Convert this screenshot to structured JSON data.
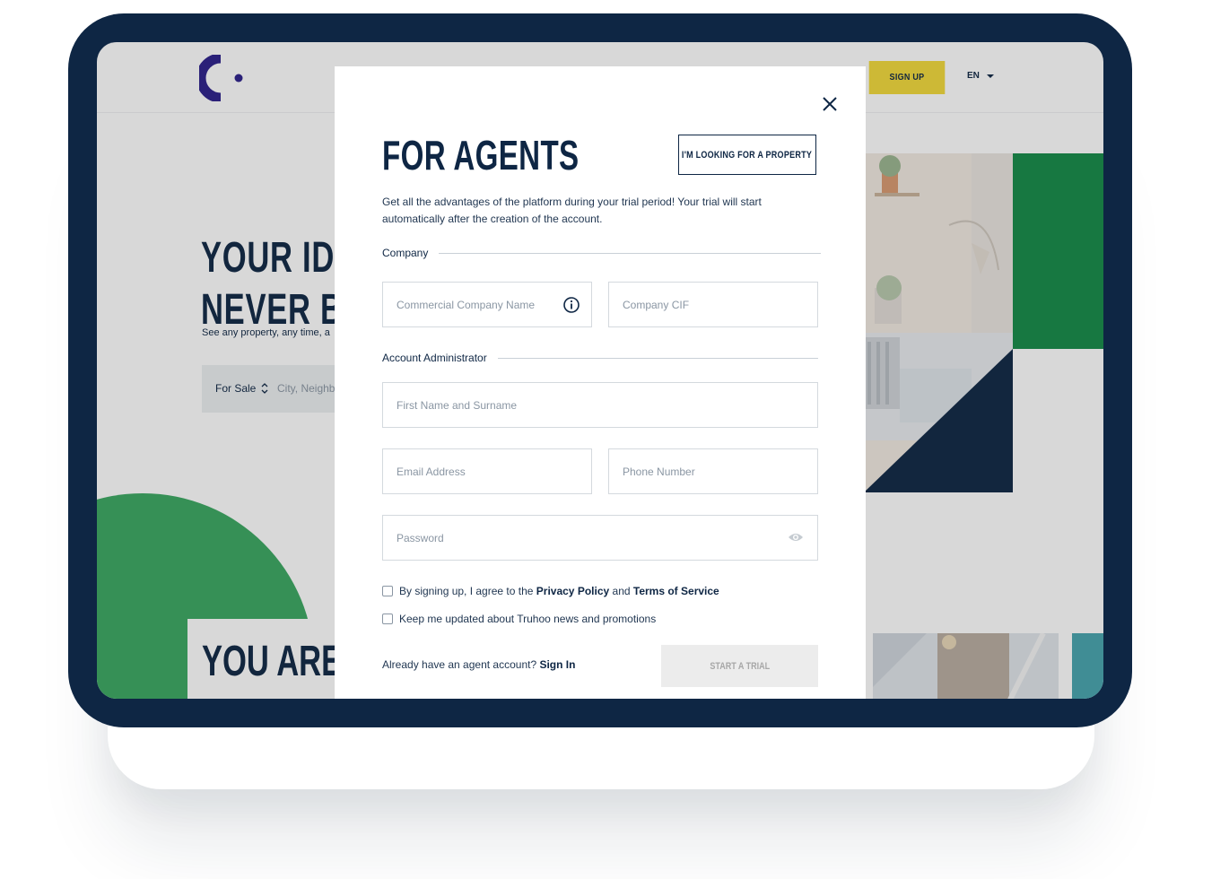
{
  "background_page": {
    "nav": {
      "signup_label": "SIGN UP",
      "lang_label": "EN"
    },
    "hero": {
      "title_line1": "YOUR IDEA",
      "title_line2": "NEVER BE",
      "subtitle": "See any property, any time, a",
      "search": {
        "type_label": "For Sale",
        "placeholder": "City, Neighb"
      }
    },
    "section_title": "YOU ARE W"
  },
  "modal": {
    "title": "FOR AGENTS",
    "switch_button_label": "I'M LOOKING FOR A PROPERTY",
    "intro": "Get all the advantages of the platform during your trial period! Your trial will start automatically after the creation of the account.",
    "company_section": "Company",
    "fields": {
      "company_name": "Commercial Company Name",
      "company_cif": "Company CIF",
      "full_name": "First Name and Surname",
      "email": "Email Address",
      "phone": "Phone Number",
      "password": "Password"
    },
    "admin_section": "Account Administrator",
    "terms": {
      "prefix": "By signing up, I agree to the",
      "privacy": "Privacy Policy",
      "and": "and",
      "tos": "Terms of Service"
    },
    "newsletter": "Keep me updated about Truhoo news and promotions",
    "signin": {
      "prompt": "Already have an agent account?",
      "link": "Sign In"
    },
    "start_button_label": "START A TRIAL"
  },
  "colors": {
    "navy": "#0e2644",
    "green": "#148a47",
    "yellow": "#f2d93a",
    "teal": "#46a4ae"
  },
  "icons": [
    "logo-c-icon",
    "close-icon",
    "info-icon",
    "eye-icon",
    "sort-chevron-icon",
    "caret-down-icon"
  ]
}
